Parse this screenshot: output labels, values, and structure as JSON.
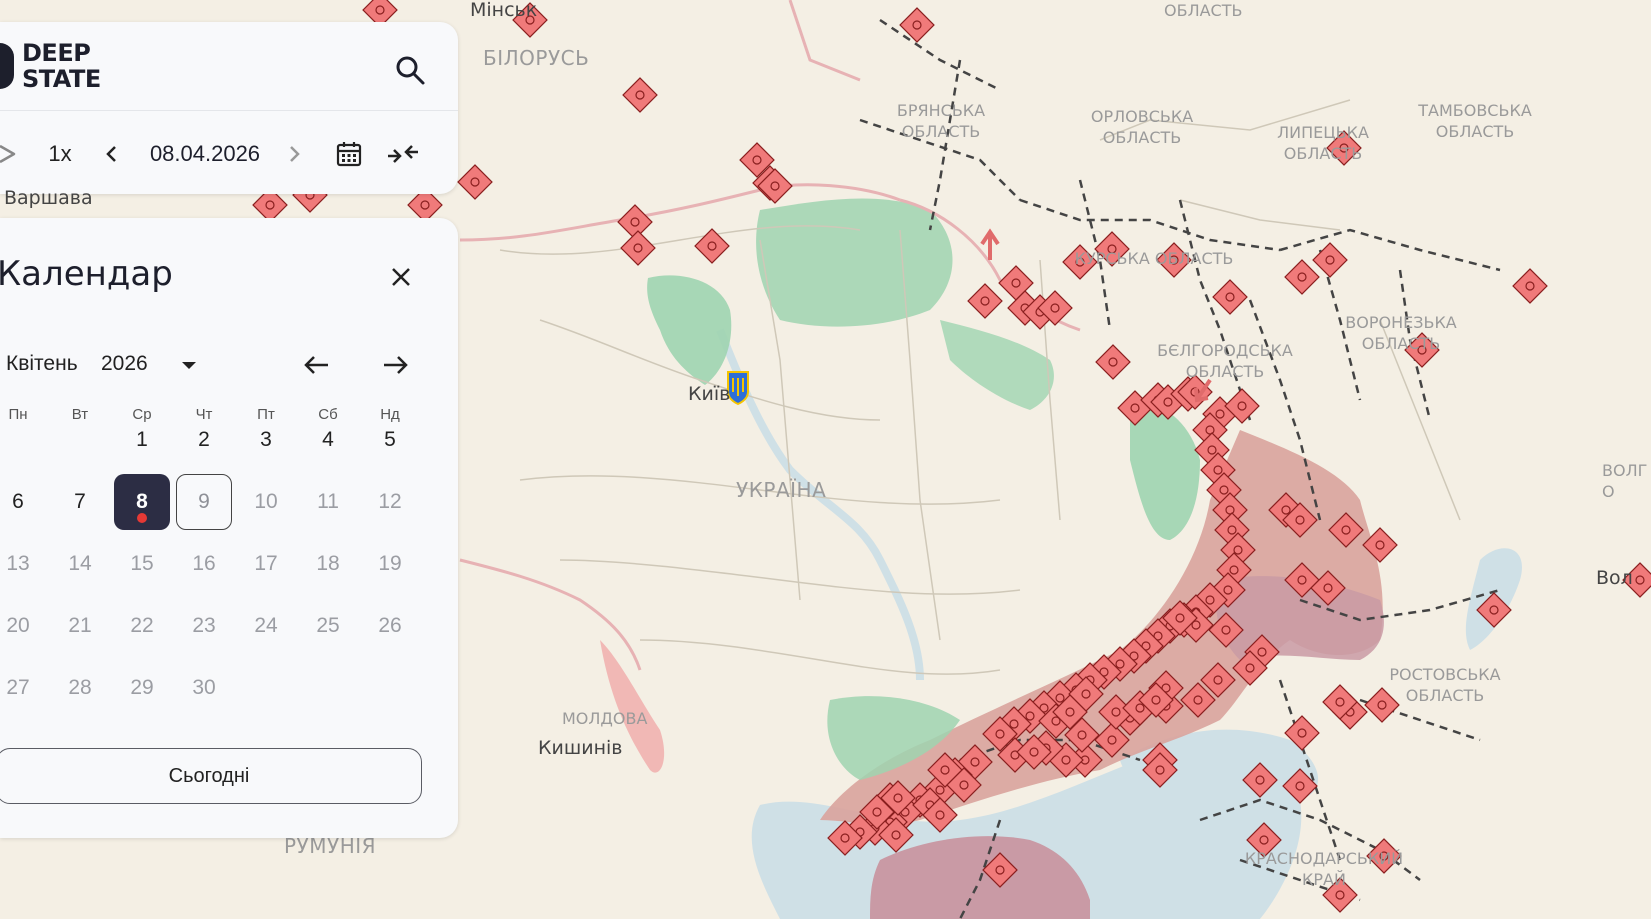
{
  "app": {
    "logo_line1": "DEEP",
    "logo_line2": "STATE"
  },
  "toolbar": {
    "speed": "1x",
    "date": "08.04.2026"
  },
  "calendar": {
    "title": "Календар",
    "month": "Квітень",
    "year": "2026",
    "weekdays": [
      "Пн",
      "Вт",
      "Ср",
      "Чт",
      "Пт",
      "Сб",
      "Нд"
    ],
    "days": [
      "1",
      "2",
      "3",
      "4",
      "5",
      "6",
      "7",
      "8",
      "9",
      "10",
      "11",
      "12",
      "13",
      "14",
      "15",
      "16",
      "17",
      "18",
      "19",
      "20",
      "21",
      "22",
      "23",
      "24",
      "25",
      "26",
      "27",
      "28",
      "29",
      "30"
    ],
    "selected_day": "8",
    "today_day": "9",
    "today_button": "Сьогодні"
  },
  "map_labels": {
    "belarus": "БІЛОРУСЬ",
    "minsk": "Мінськ",
    "warsaw": "Варшава",
    "ukraine": "УКРАЇНА",
    "kyiv": "Київ",
    "moldova": "МОЛДОВА",
    "chisinau": "Кишинів",
    "romania": "РУМУНІЯ",
    "oblast_top": "ОБЛАСТЬ",
    "bryansk": "БРЯНСЬКА ОБЛАСТЬ",
    "orel": "ОРЛОВСЬКА ОБЛАСТЬ",
    "lipetsk": "ЛИПЕЦЬКА ОБЛАСТЬ",
    "tambov": "ТАМБОВСЬКА ОБЛАСТЬ",
    "kursk": "КУРСЬКА ОБЛАСТЬ",
    "voronezh": "ВОРОНЕЗЬКА ОБЛАСТЬ",
    "belgorod": "БЄЛГОРОДСЬКА ОБЛАСТЬ",
    "rostov": "РОСТОВСЬКА ОБЛАСТЬ",
    "krasnodar": "КРАСНОДАРСЬКИЙ КРАЙ",
    "volgograd_obl": "ВОЛГ О",
    "volgograd": "Вол"
  },
  "colors": {
    "land": "#f4efe4",
    "water": "#cfe0e6",
    "occupied": "#d9a39c",
    "crimea": "#c99aa5",
    "liberated": "#9fd4b0",
    "marker_fill": "#f07a7a",
    "marker_stroke": "#8a1f1f",
    "panel_bg": "#f8f9fb",
    "selected_day": "#2c2d44",
    "dot": "#e53935"
  }
}
